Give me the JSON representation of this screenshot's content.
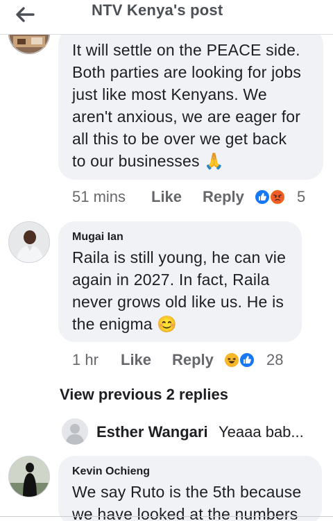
{
  "header": {
    "title": "NTV Kenya's post"
  },
  "comments": [
    {
      "text_lines": [
        "It will settle on the PEACE side.",
        "Both parties are looking for jobs",
        "just like most Kenyans. We",
        "aren't anxious, we are eager for",
        "all this to be over we get back",
        "to our businesses 🙏"
      ],
      "time": "51 mins",
      "like_label": "Like",
      "reply_label": "Reply",
      "reactions": [
        "like-reaction",
        "angry-reaction"
      ],
      "reaction_count": "5"
    },
    {
      "author": "Mugai Ian",
      "text_lines": [
        "Raila is still young, he can vie",
        "again in 2027. In fact, Raila",
        "never grows old like us. He is",
        "the enigma 😊"
      ],
      "time": "1 hr",
      "like_label": "Like",
      "reply_label": "Reply",
      "reactions": [
        "haha-reaction",
        "like-reaction"
      ],
      "reaction_count": "28"
    }
  ],
  "view_previous": "View previous 2 replies",
  "reply_preview": {
    "author": "Esther Wangari",
    "text": "Yeaaa bab..."
  },
  "third_comment": {
    "author": "Kevin Ochieng",
    "text_lines": [
      "We say Ruto is the 5th because",
      "we have looked at the numbers"
    ]
  },
  "colors": {
    "bubble": "#f0f2f5",
    "meta": "#65676b",
    "like_blue": "#1877f2",
    "angry_orange": "#e9710f"
  }
}
